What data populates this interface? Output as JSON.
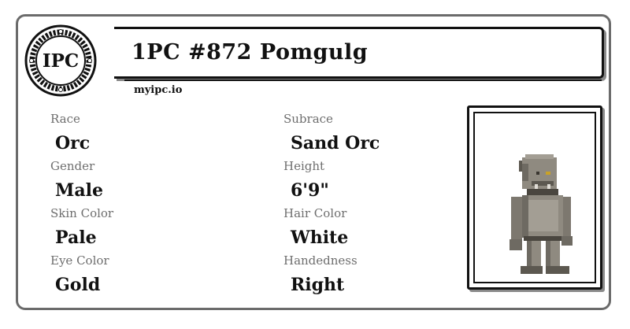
{
  "logo": {
    "text": "IPC"
  },
  "card": {
    "title": "1PC #872 Pomgulg",
    "site": "myipc.io"
  },
  "fields": {
    "race": {
      "label": "Race",
      "value": "Orc"
    },
    "subrace": {
      "label": "Subrace",
      "value": "Sand Orc"
    },
    "gender": {
      "label": "Gender",
      "value": "Male"
    },
    "height": {
      "label": "Height",
      "value": "6'9\""
    },
    "skin_color": {
      "label": "Skin Color",
      "value": "Pale"
    },
    "hair_color": {
      "label": "Hair Color",
      "value": "White"
    },
    "eye_color": {
      "label": "Eye Color",
      "value": "Gold"
    },
    "handedness": {
      "label": "Handedness",
      "value": "Right"
    }
  },
  "colors": {
    "border": "#6b6b6b",
    "ink": "#111111",
    "label": "#6e6e6e",
    "skin": "#8f8a80",
    "eye": "#c9a227"
  },
  "portrait": {
    "icon": "orc-character-sprite"
  }
}
